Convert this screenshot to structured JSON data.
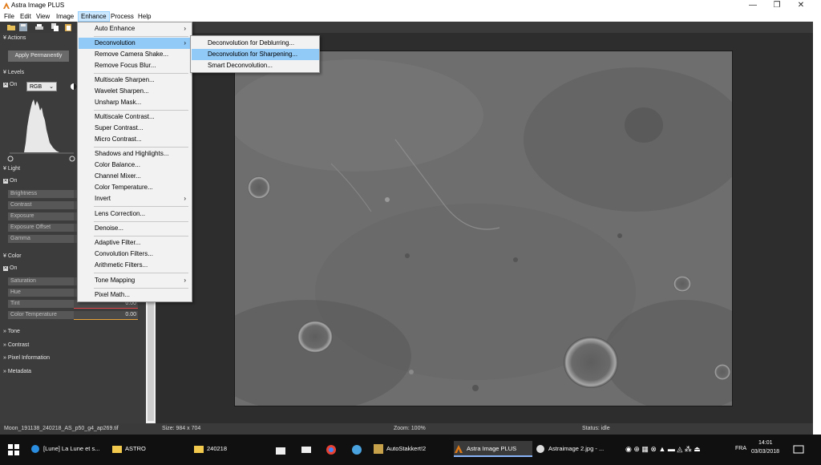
{
  "app": {
    "title": "Astra Image PLUS",
    "window_controls": [
      "—",
      "❐",
      "✕"
    ]
  },
  "menubar": [
    "File",
    "Edit",
    "View",
    "Image",
    "Enhance",
    "Process",
    "Help"
  ],
  "left_panel": {
    "actions_header": "Actions",
    "apply_button": "Apply Permanently",
    "levels_header": "Levels",
    "levels_on": "On",
    "channel": "RGB",
    "light_header": "Light",
    "light_on": "On",
    "light_rows": [
      "Brightness",
      "Contrast",
      "Exposure",
      "Exposure Offset",
      "Gamma"
    ],
    "color_header": "Color",
    "color_on": "On",
    "color_rows": [
      {
        "label": "Saturation",
        "value": ""
      },
      {
        "label": "Hue",
        "value": ""
      },
      {
        "label": "Tint",
        "value": "0.00"
      },
      {
        "label": "Color Temperature",
        "value": "0.00"
      }
    ],
    "collapsed": [
      "Tone",
      "Contrast",
      "Pixel Information",
      "Metadata"
    ]
  },
  "enhance_menu": {
    "items": [
      "Auto Enhance",
      "Deconvolution",
      "Remove Camera Shake...",
      "Remove Focus Blur...",
      "Multiscale Sharpen...",
      "Wavelet Sharpen...",
      "Unsharp Mask...",
      "Multiscale Contrast...",
      "Super Contrast...",
      "Micro Contrast...",
      "Shadows and Highlights...",
      "Color Balance...",
      "Channel Mixer...",
      "Color Temperature...",
      "Invert",
      "Lens Correction...",
      "Denoise...",
      "Adaptive Filter...",
      "Convolution Filters...",
      "Arithmetic Filters...",
      "Tone Mapping",
      "Pixel Math..."
    ],
    "submenu_arrow": "›"
  },
  "deconvolution_submenu": [
    "Deconvolution for Deblurring...",
    "Deconvolution for Sharpening...",
    "Smart Deconvolution..."
  ],
  "statusbar": {
    "filename": "Moon_191138_240218_AS_p50_g4_ap269.tif",
    "size": "Size: 984 x 704",
    "zoom": "Zoom: 100%",
    "status": "Status: idle"
  },
  "taskbar": {
    "tasks": [
      "[Lune] La Lune et s...",
      "ASTRO",
      "240218",
      "AutoStakkert!2",
      "Astra Image PLUS",
      "Astraimage 2.jpg - ..."
    ],
    "lang": "FRA",
    "time": "14:01",
    "date": "03/03/2018"
  },
  "colors": {
    "accent": "#91c9f7",
    "panel": "#3c3c3c",
    "tint_bar": "#e0464a",
    "temp_bar": "#e8a23a"
  }
}
